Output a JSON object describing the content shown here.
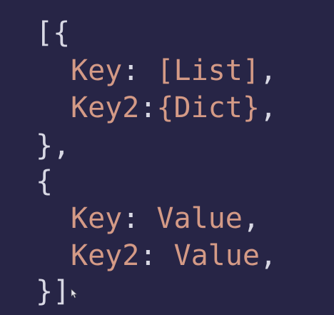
{
  "code": {
    "line1": "[{",
    "line2": {
      "key": "Key",
      "sep": ": ",
      "value": "[List]",
      "end": ","
    },
    "line3": {
      "key": "Key2",
      "sep": ":",
      "value": "{Dict}",
      "end": ","
    },
    "line4": "},",
    "line5": "{",
    "line6": {
      "key": "Key",
      "sep": ": ",
      "value": "Value",
      "end": ","
    },
    "line7": {
      "key": "Key2",
      "sep": ": ",
      "value": "Value",
      "end": ","
    },
    "line8": "}]"
  },
  "colors": {
    "background": "#272546",
    "key": "#d49a86",
    "punctuation": "#d8d8e4"
  },
  "icons": {
    "cursor": "mouse-pointer-icon"
  }
}
